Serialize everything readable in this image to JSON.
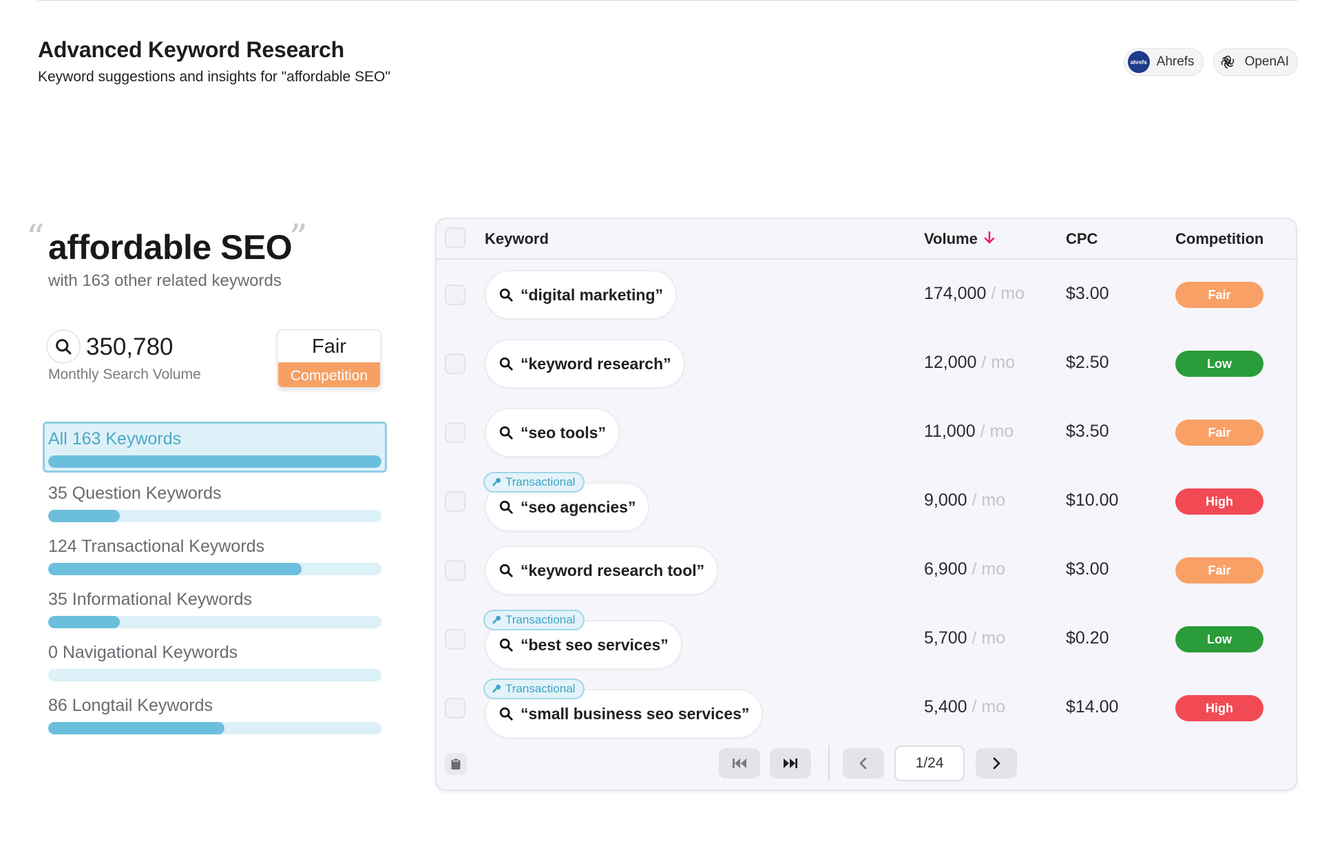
{
  "header": {
    "title": "Advanced Keyword Research",
    "subtitle": "Keyword suggestions and insights for \"affordable SEO\""
  },
  "providers": [
    {
      "name": "Ahrefs",
      "logo_text": "ahrefs",
      "icon": "ahrefs-logo-icon"
    },
    {
      "name": "OpenAI",
      "icon": "openai-logo-icon"
    }
  ],
  "summary": {
    "keyword": "affordable SEO",
    "related_text": "with 163 other related keywords",
    "volume": "350,780",
    "volume_label": "Monthly Search Volume",
    "competition_level": "Fair",
    "competition_label": "Competition"
  },
  "categories": [
    {
      "label": "All 163 Keywords",
      "fraction": 1.0,
      "active": true
    },
    {
      "label": "35 Question Keywords",
      "fraction": 0.215
    },
    {
      "label": "124 Transactional Keywords",
      "fraction": 0.761
    },
    {
      "label": "35 Informational Keywords",
      "fraction": 0.215
    },
    {
      "label": "0 Navigational Keywords",
      "fraction": 0.0
    },
    {
      "label": "86 Longtail Keywords",
      "fraction": 0.528
    }
  ],
  "table": {
    "columns": {
      "keyword": "Keyword",
      "volume": "Volume",
      "cpc": "CPC",
      "competition": "Competition"
    },
    "volume_unit": "/ mo",
    "rows": [
      {
        "keyword": "“digital marketing”",
        "volume": "174,000",
        "cpc": "$3.00",
        "competition": "Fair",
        "intent": ""
      },
      {
        "keyword": "“keyword research”",
        "volume": "12,000",
        "cpc": "$2.50",
        "competition": "Low",
        "intent": ""
      },
      {
        "keyword": "“seo tools”",
        "volume": "11,000",
        "cpc": "$3.50",
        "competition": "Fair",
        "intent": ""
      },
      {
        "keyword": "“seo agencies”",
        "volume": "9,000",
        "cpc": "$10.00",
        "competition": "High",
        "intent": "Transactional"
      },
      {
        "keyword": "“keyword research tool”",
        "volume": "6,900",
        "cpc": "$3.00",
        "competition": "Fair",
        "intent": ""
      },
      {
        "keyword": "“best seo services”",
        "volume": "5,700",
        "cpc": "$0.20",
        "competition": "Low",
        "intent": "Transactional"
      },
      {
        "keyword": "“small business seo services”",
        "volume": "5,400",
        "cpc": "$14.00",
        "competition": "High",
        "intent": "Transactional"
      }
    ]
  },
  "competition_colors": {
    "Fair": "#f9a066",
    "Low": "#2a9c3a",
    "High": "#f24a55"
  },
  "pagination": {
    "page": "1/24"
  }
}
